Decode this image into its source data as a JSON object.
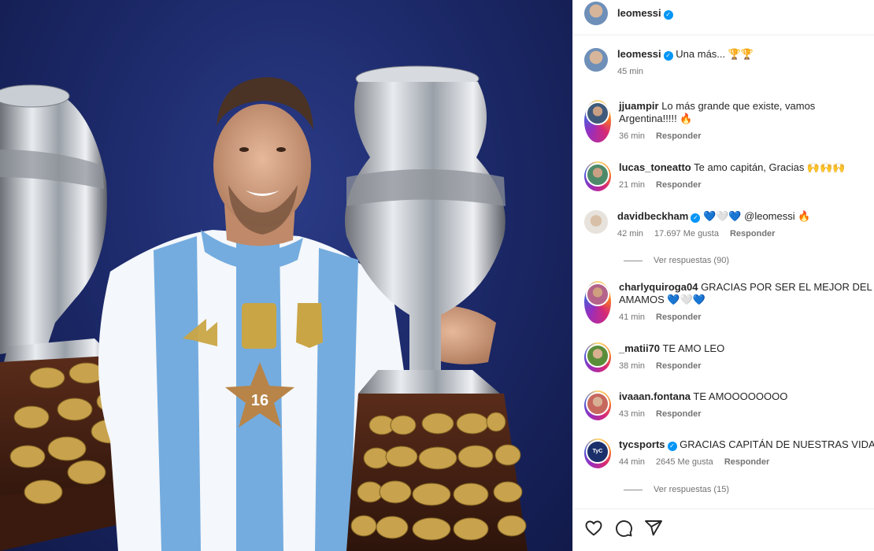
{
  "post": {
    "author": "leomessi",
    "caption_text": "Una más... 🏆🏆",
    "caption_time": "45 min"
  },
  "comments": [
    {
      "user": "jjuampir",
      "verified": false,
      "text": "Lo más grande que existe, vamos Argentina!!!!! 🔥",
      "time": "36 min",
      "likes": "",
      "reply": "Responder"
    },
    {
      "user": "lucas_toneatto",
      "verified": false,
      "text": "Te amo capitán, Gracias 🙌🙌🙌",
      "time": "21 min",
      "likes": "",
      "reply": "Responder"
    },
    {
      "user": "davidbeckham",
      "verified": true,
      "text": "💙🤍💙 @leomessi 🔥",
      "time": "42 min",
      "likes": "17.697 Me gusta",
      "reply": "Responder",
      "view_replies": "Ver respuestas (90)"
    },
    {
      "user": "charlyquiroga04",
      "verified": false,
      "text": "GRACIAS POR SER EL MEJOR DEL MUN",
      "text2": "AMAMOS 💙🤍💙",
      "time": "41 min",
      "likes": "",
      "reply": "Responder"
    },
    {
      "user": "_matii70",
      "verified": false,
      "text": "TE AMO LEO",
      "time": "38 min",
      "likes": "",
      "reply": "Responder"
    },
    {
      "user": "ivaaan.fontana",
      "verified": false,
      "text": "TE AMOOOOOOOO",
      "time": "43 min",
      "likes": "",
      "reply": "Responder"
    },
    {
      "user": "tycsports",
      "verified": true,
      "text": "GRACIAS CAPITÁN DE NUESTRAS VIDAS 💙",
      "time": "44 min",
      "likes": "2645 Me gusta",
      "reply": "Responder",
      "view_replies": "Ver respuestas (15)"
    }
  ],
  "actions": {
    "like": "heart-icon",
    "comment": "comment-icon",
    "share": "share-icon"
  },
  "colors": {
    "verified": "#0095f6",
    "jersey_blue": "#74acdf",
    "backdrop": "#1d2a6b"
  }
}
